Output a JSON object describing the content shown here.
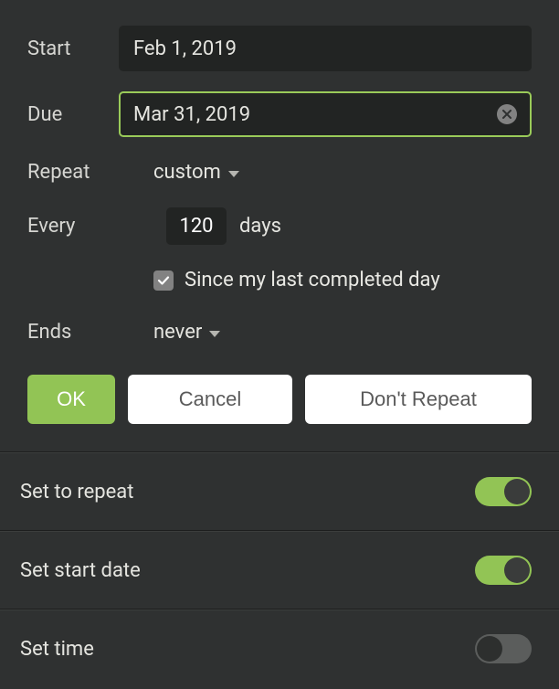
{
  "labels": {
    "start": "Start",
    "due": "Due",
    "repeat": "Repeat",
    "every": "Every",
    "ends": "Ends",
    "days": "days"
  },
  "dates": {
    "start": "Feb 1, 2019",
    "due": "Mar 31, 2019"
  },
  "repeat": {
    "mode": "custom",
    "interval": "120",
    "since_last_completed": true,
    "since_label": "Since my last completed day",
    "ends": "never"
  },
  "buttons": {
    "ok": "OK",
    "cancel": "Cancel",
    "dont_repeat": "Don't Repeat"
  },
  "toggles": {
    "set_to_repeat": {
      "label": "Set to repeat",
      "on": true
    },
    "set_start_date": {
      "label": "Set start date",
      "on": true
    },
    "set_time": {
      "label": "Set time",
      "on": false
    }
  },
  "colors": {
    "accent": "#92c455",
    "bg": "#2f3131",
    "input_bg": "#222423"
  }
}
